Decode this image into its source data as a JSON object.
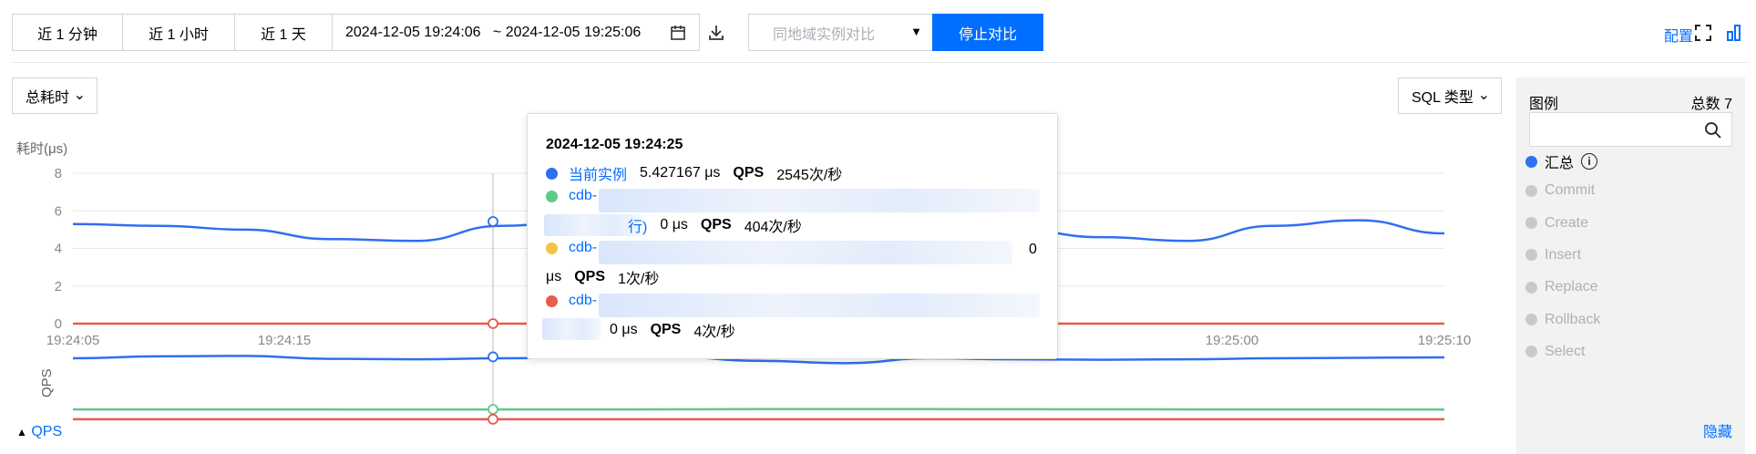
{
  "toolbar": {
    "range_1m": "近 1 分钟",
    "range_1h": "近 1 小时",
    "range_1d": "近 1 天",
    "date_range": "2024-12-05 19:24:06   ~ 2024-12-05 19:25:06",
    "compare_placeholder": "同地域实例对比",
    "stop_compare": "停止对比",
    "config": "配置"
  },
  "filters": {
    "metric_select": "总耗时",
    "sql_type_select": "SQL 类型"
  },
  "legend": {
    "title": "图例",
    "total": "总数 7",
    "search_placeholder": "",
    "items": [
      {
        "label": "汇总",
        "active": true,
        "color": "#2f6ff0"
      },
      {
        "label": "Commit",
        "active": false
      },
      {
        "label": "Create",
        "active": false
      },
      {
        "label": "Insert",
        "active": false
      },
      {
        "label": "Replace",
        "active": false
      },
      {
        "label": "Rollback",
        "active": false
      },
      {
        "label": "Select",
        "active": false
      }
    ],
    "hide": "隐藏"
  },
  "chart": {
    "ylabel": "耗时(μs)",
    "qps_label": "QPS",
    "qps_toggle": "QPS",
    "yticks": [
      "8",
      "6",
      "4",
      "2",
      "0"
    ],
    "xticks": [
      "19:24:05",
      "19:24:15",
      "19:25:00",
      "19:25:10"
    ]
  },
  "tooltip": {
    "time": "2024-12-05 19:24:25",
    "rows": [
      {
        "name": "当前实例",
        "value": "5.427167 μs",
        "qps_label": "QPS",
        "qps": "2545次/秒",
        "color": "#2f6ff0"
      },
      {
        "name": "cdb-",
        "suffix": "行)",
        "value": "0 μs",
        "qps_label": "QPS",
        "qps": "404次/秒",
        "color": "#5ec98a"
      },
      {
        "name": "cdb-",
        "value": "0",
        "value_unit": "μs",
        "qps_label": "QPS",
        "qps": "1次/秒",
        "color": "#f6c444"
      },
      {
        "name": "cdb-",
        "value": "0 μs",
        "qps_label": "QPS",
        "qps": "4次/秒",
        "color": "#e85b4e"
      }
    ]
  },
  "chart_data": {
    "type": "line",
    "ylim": [
      0,
      8
    ],
    "series": [
      {
        "name": "当前实例",
        "color": "#2f6ff0",
        "values": [
          5.3,
          5.2,
          5.0,
          4.5,
          4.4,
          5.2,
          5.5,
          5.43,
          5.3,
          5.4,
          5.3,
          5.0,
          4.6,
          4.4,
          5.2,
          5.5,
          4.8
        ]
      },
      {
        "name": "cdb-",
        "color": "#e85b4e",
        "values": [
          0,
          0,
          0,
          0,
          0,
          0,
          0,
          0,
          0,
          0,
          0,
          0,
          0,
          0,
          0,
          0,
          0
        ]
      }
    ],
    "qps_series": [
      {
        "name": "当前实例",
        "color": "#2f6ff0",
        "values": [
          2500,
          2580,
          2600,
          2480,
          2460,
          2500,
          2545,
          2560,
          2400,
          2300,
          2500,
          2460,
          2440,
          2460,
          2500,
          2520,
          2540
        ]
      },
      {
        "name": "cdb-",
        "color": "#5ec98a",
        "values": [
          404,
          404,
          404,
          404,
          400,
          404,
          404,
          410,
          420,
          420,
          420,
          415,
          410,
          408,
          406,
          404,
          400
        ]
      },
      {
        "name": "cdb-",
        "color": "#e85b4e",
        "values": [
          4,
          4,
          4,
          4,
          4,
          4,
          4,
          4,
          4,
          4,
          4,
          4,
          4,
          4,
          4,
          4,
          4
        ]
      }
    ]
  }
}
